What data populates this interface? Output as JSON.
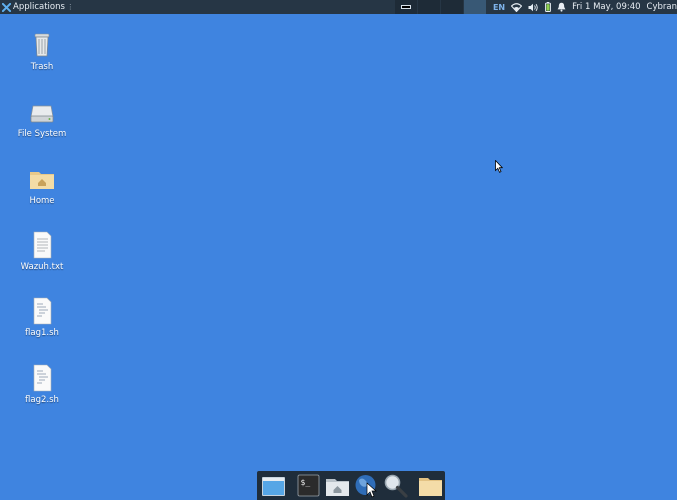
{
  "panel": {
    "applications_label": "Applications",
    "language": "EN",
    "clock": "Fri  1 May, 09:40",
    "user": "Cybran",
    "icons": [
      "xfce-logo-icon",
      "workspace-switcher",
      "wifi-icon",
      "volume-icon",
      "battery-icon",
      "notification-bell-icon"
    ]
  },
  "desktop": {
    "icons": [
      {
        "label": "Trash",
        "icon": "trash-icon"
      },
      {
        "label": "File System",
        "icon": "drive-icon"
      },
      {
        "label": "Home",
        "icon": "home-folder-icon"
      },
      {
        "label": "Wazuh.txt",
        "icon": "text-file-icon"
      },
      {
        "label": "flag1.sh",
        "icon": "script-file-icon"
      },
      {
        "label": "flag2.sh",
        "icon": "script-file-icon"
      }
    ]
  },
  "dock": {
    "items": [
      "show-desktop-icon",
      "terminal-icon",
      "home-folder-icon",
      "web-browser-icon",
      "search-icon",
      "folder-icon"
    ]
  },
  "colors": {
    "desktop_bg": "#3f84e0",
    "panel_bg": "#263645",
    "dock_bg": "#1f2d3b",
    "lang_color": "#7fb3ea"
  }
}
